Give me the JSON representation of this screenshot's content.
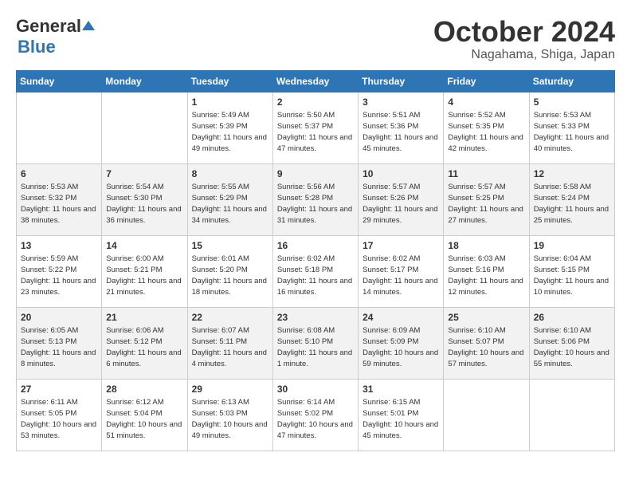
{
  "logo": {
    "general": "General",
    "blue": "Blue"
  },
  "title": "October 2024",
  "location": "Nagahama, Shiga, Japan",
  "days_of_week": [
    "Sunday",
    "Monday",
    "Tuesday",
    "Wednesday",
    "Thursday",
    "Friday",
    "Saturday"
  ],
  "weeks": [
    [
      {
        "day": "",
        "content": ""
      },
      {
        "day": "",
        "content": ""
      },
      {
        "day": "1",
        "content": "Sunrise: 5:49 AM\nSunset: 5:39 PM\nDaylight: 11 hours and 49 minutes."
      },
      {
        "day": "2",
        "content": "Sunrise: 5:50 AM\nSunset: 5:37 PM\nDaylight: 11 hours and 47 minutes."
      },
      {
        "day": "3",
        "content": "Sunrise: 5:51 AM\nSunset: 5:36 PM\nDaylight: 11 hours and 45 minutes."
      },
      {
        "day": "4",
        "content": "Sunrise: 5:52 AM\nSunset: 5:35 PM\nDaylight: 11 hours and 42 minutes."
      },
      {
        "day": "5",
        "content": "Sunrise: 5:53 AM\nSunset: 5:33 PM\nDaylight: 11 hours and 40 minutes."
      }
    ],
    [
      {
        "day": "6",
        "content": "Sunrise: 5:53 AM\nSunset: 5:32 PM\nDaylight: 11 hours and 38 minutes."
      },
      {
        "day": "7",
        "content": "Sunrise: 5:54 AM\nSunset: 5:30 PM\nDaylight: 11 hours and 36 minutes."
      },
      {
        "day": "8",
        "content": "Sunrise: 5:55 AM\nSunset: 5:29 PM\nDaylight: 11 hours and 34 minutes."
      },
      {
        "day": "9",
        "content": "Sunrise: 5:56 AM\nSunset: 5:28 PM\nDaylight: 11 hours and 31 minutes."
      },
      {
        "day": "10",
        "content": "Sunrise: 5:57 AM\nSunset: 5:26 PM\nDaylight: 11 hours and 29 minutes."
      },
      {
        "day": "11",
        "content": "Sunrise: 5:57 AM\nSunset: 5:25 PM\nDaylight: 11 hours and 27 minutes."
      },
      {
        "day": "12",
        "content": "Sunrise: 5:58 AM\nSunset: 5:24 PM\nDaylight: 11 hours and 25 minutes."
      }
    ],
    [
      {
        "day": "13",
        "content": "Sunrise: 5:59 AM\nSunset: 5:22 PM\nDaylight: 11 hours and 23 minutes."
      },
      {
        "day": "14",
        "content": "Sunrise: 6:00 AM\nSunset: 5:21 PM\nDaylight: 11 hours and 21 minutes."
      },
      {
        "day": "15",
        "content": "Sunrise: 6:01 AM\nSunset: 5:20 PM\nDaylight: 11 hours and 18 minutes."
      },
      {
        "day": "16",
        "content": "Sunrise: 6:02 AM\nSunset: 5:18 PM\nDaylight: 11 hours and 16 minutes."
      },
      {
        "day": "17",
        "content": "Sunrise: 6:02 AM\nSunset: 5:17 PM\nDaylight: 11 hours and 14 minutes."
      },
      {
        "day": "18",
        "content": "Sunrise: 6:03 AM\nSunset: 5:16 PM\nDaylight: 11 hours and 12 minutes."
      },
      {
        "day": "19",
        "content": "Sunrise: 6:04 AM\nSunset: 5:15 PM\nDaylight: 11 hours and 10 minutes."
      }
    ],
    [
      {
        "day": "20",
        "content": "Sunrise: 6:05 AM\nSunset: 5:13 PM\nDaylight: 11 hours and 8 minutes."
      },
      {
        "day": "21",
        "content": "Sunrise: 6:06 AM\nSunset: 5:12 PM\nDaylight: 11 hours and 6 minutes."
      },
      {
        "day": "22",
        "content": "Sunrise: 6:07 AM\nSunset: 5:11 PM\nDaylight: 11 hours and 4 minutes."
      },
      {
        "day": "23",
        "content": "Sunrise: 6:08 AM\nSunset: 5:10 PM\nDaylight: 11 hours and 1 minute."
      },
      {
        "day": "24",
        "content": "Sunrise: 6:09 AM\nSunset: 5:09 PM\nDaylight: 10 hours and 59 minutes."
      },
      {
        "day": "25",
        "content": "Sunrise: 6:10 AM\nSunset: 5:07 PM\nDaylight: 10 hours and 57 minutes."
      },
      {
        "day": "26",
        "content": "Sunrise: 6:10 AM\nSunset: 5:06 PM\nDaylight: 10 hours and 55 minutes."
      }
    ],
    [
      {
        "day": "27",
        "content": "Sunrise: 6:11 AM\nSunset: 5:05 PM\nDaylight: 10 hours and 53 minutes."
      },
      {
        "day": "28",
        "content": "Sunrise: 6:12 AM\nSunset: 5:04 PM\nDaylight: 10 hours and 51 minutes."
      },
      {
        "day": "29",
        "content": "Sunrise: 6:13 AM\nSunset: 5:03 PM\nDaylight: 10 hours and 49 minutes."
      },
      {
        "day": "30",
        "content": "Sunrise: 6:14 AM\nSunset: 5:02 PM\nDaylight: 10 hours and 47 minutes."
      },
      {
        "day": "31",
        "content": "Sunrise: 6:15 AM\nSunset: 5:01 PM\nDaylight: 10 hours and 45 minutes."
      },
      {
        "day": "",
        "content": ""
      },
      {
        "day": "",
        "content": ""
      }
    ]
  ]
}
